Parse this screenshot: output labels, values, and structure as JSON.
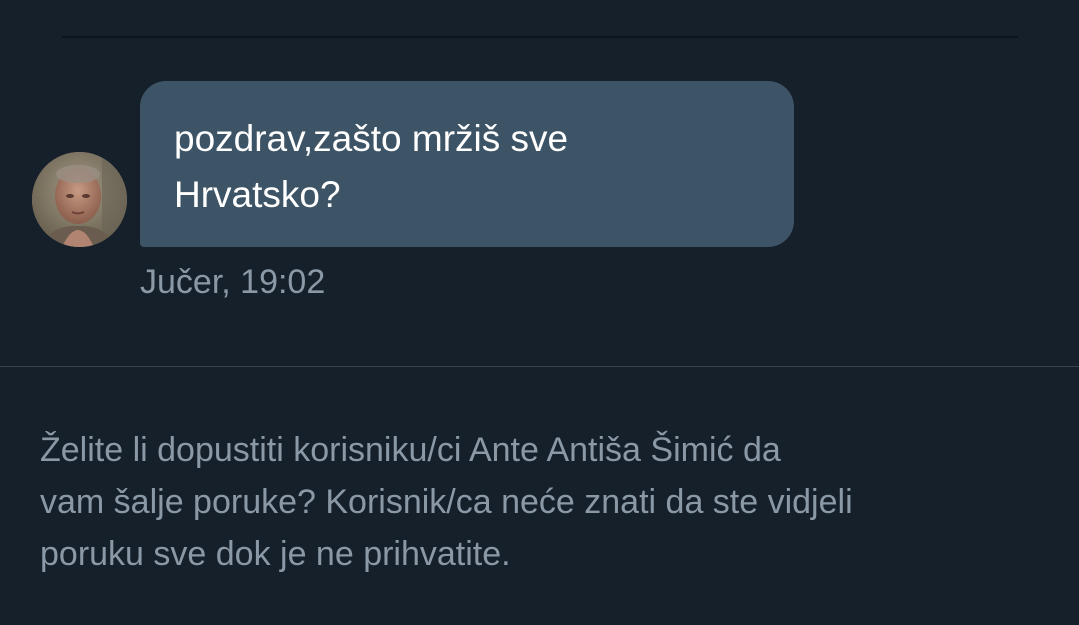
{
  "conversation": {
    "message": {
      "text_line1": "pozdrav,zašto mržiš sve",
      "text_line2": "Hrvatsko?",
      "timestamp": "Jučer, 19:02"
    },
    "request": {
      "line1": "Želite li dopustiti korisniku/ci Ante Antiša Šimić da",
      "line2": "vam šalje poruke? Korisnik/ca neće znati da ste vidjeli",
      "line3": "poruku sve dok je ne prihvatite."
    }
  },
  "colors": {
    "background": "#15202b",
    "bubble": "#3d5466",
    "secondary_text": "#8b98a5",
    "divider": "#38444d"
  }
}
